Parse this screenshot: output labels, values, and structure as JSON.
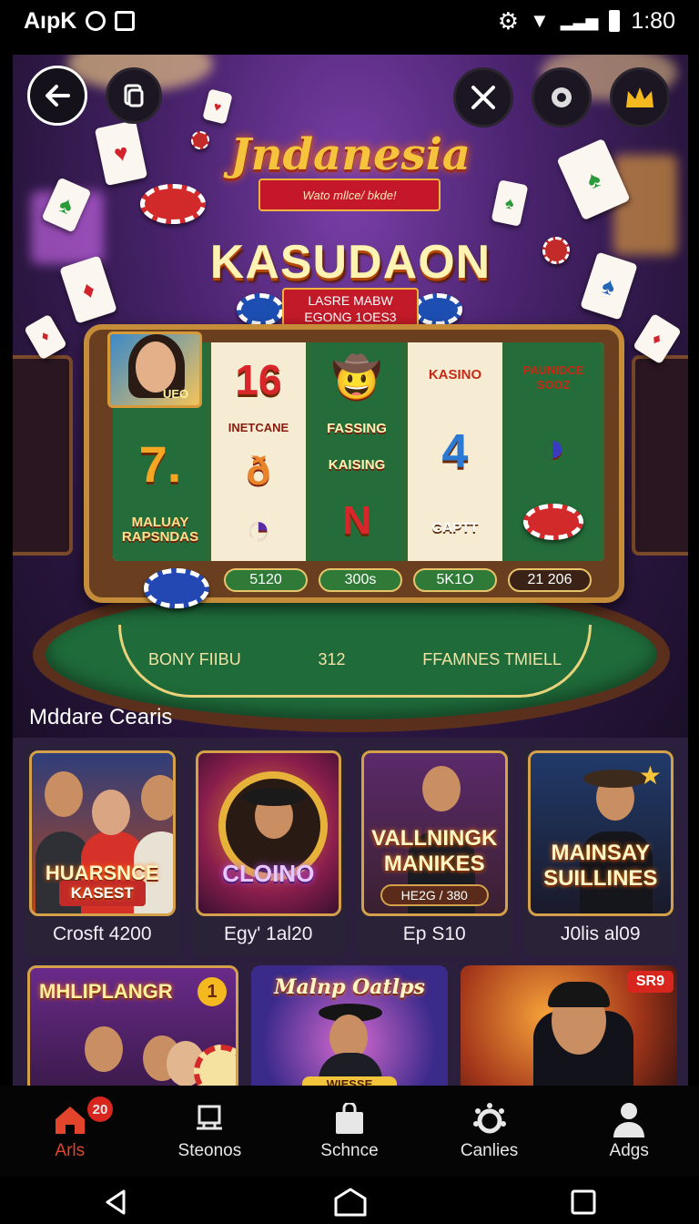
{
  "status_bar": {
    "left_text": "AıpK",
    "time": "1:80"
  },
  "hero": {
    "script_title": "Jndanesia",
    "ribbon_text": "Wato mllce/ bkde!",
    "main_title": "KASUDAON",
    "sub_ribbon_line1": "LASRE MABW",
    "sub_ribbon_line2": "EGONG 1OES3",
    "portrait_label": "UEO",
    "reels": [
      [
        "7.",
        "MALUAY RAPSNDAS"
      ],
      [
        "16",
        "INETCANE",
        "ð",
        ""
      ],
      [
        "FASSING",
        "",
        "KAISING",
        "N"
      ],
      [
        "KASINO",
        "4",
        "GAPTT",
        ""
      ],
      [
        "PAUNIDCE SOOZ",
        "",
        ""
      ]
    ],
    "paylines": [
      "51‌20",
      "300s",
      "5K1O",
      "21 206"
    ],
    "felt_left": "BONY FIIBU",
    "felt_center": "312",
    "felt_right": "FFAMNES TMIELL"
  },
  "section_title": "Mddare Cearis",
  "featured": [
    {
      "title_line1": "HUARSNCE",
      "title_line2": "KASEST",
      "caption": "Crosft 4200"
    },
    {
      "title_line1": "CLOINO",
      "title_line2": "",
      "caption": "Egy' 1al20"
    },
    {
      "title_line1": "VALLNINGK",
      "title_line2": "MANIKES",
      "sub": "HE2G / 380",
      "caption": "Ep S10"
    },
    {
      "title_line1": "MAINSAY",
      "title_line2": "SUILLINES",
      "caption": "J0lis al09"
    }
  ],
  "more": [
    {
      "title": "MHLIPLANGR",
      "badge": "1"
    },
    {
      "title": "Malnp Oatlps",
      "sub": "WIESSE"
    },
    {
      "badge": "SR9"
    }
  ],
  "tabs": [
    {
      "label": "Arls",
      "badge": "20",
      "active": true,
      "icon": "home-icon"
    },
    {
      "label": "Steonos",
      "icon": "monitor-icon"
    },
    {
      "label": "Schnce",
      "icon": "bag-icon"
    },
    {
      "label": "Canlies",
      "icon": "gear-icon"
    },
    {
      "label": "Adgs",
      "icon": "person-icon"
    }
  ],
  "colors": {
    "accent": "#e2452c",
    "gold": "#f6c33c",
    "felt": "#1f6b3a"
  }
}
